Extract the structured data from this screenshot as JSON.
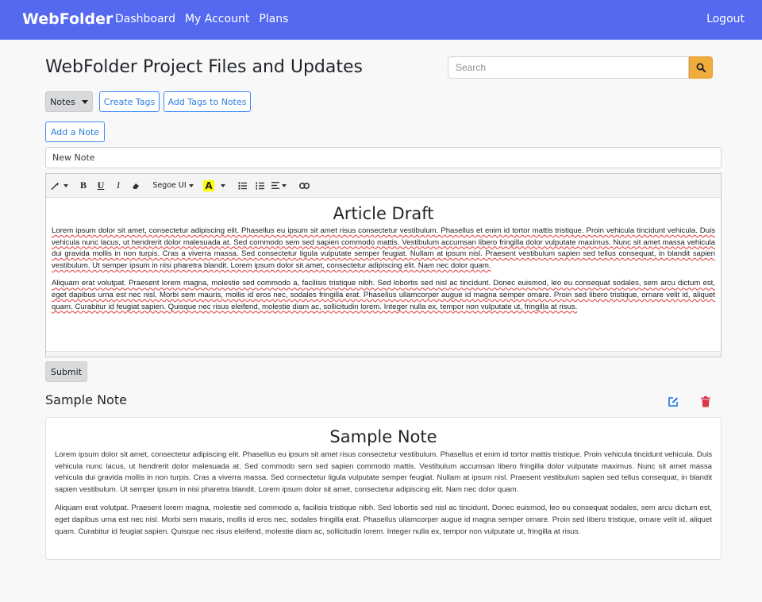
{
  "navbar": {
    "brand": "WebFolder",
    "links": [
      "Dashboard",
      "My Account",
      "Plans"
    ],
    "logout": "Logout",
    "bg_color": "#5468f0"
  },
  "page": {
    "title": "WebFolder Project Files and Updates"
  },
  "search": {
    "placeholder": "Search",
    "value": "",
    "button_icon": "search-icon",
    "button_color": "#f0ad3e"
  },
  "actions": {
    "notes_dropdown": "Notes",
    "create_tags": "Create Tags",
    "add_tags_to_notes": "Add Tags to Notes",
    "add_note": "Add a Note"
  },
  "new_note": {
    "title_value": "New Note"
  },
  "editor": {
    "toolbar": {
      "font_name": "Segoe UI",
      "icons": [
        "magic-icon",
        "bold-icon",
        "underline-icon",
        "italic-icon",
        "eraser-icon",
        "font-color-icon",
        "unordered-list-icon",
        "ordered-list-icon",
        "align-icon",
        "link-icon"
      ]
    },
    "heading": "Article Draft",
    "paragraphs": [
      "Lorem ipsum dolor sit amet, consectetur adipiscing elit. Phasellus eu ipsum sit amet risus consectetur vestibulum. Phasellus et enim id tortor mattis tristique. Proin vehicula tincidunt vehicula. Duis vehicula nunc lacus, ut hendrerit dolor malesuada at. Sed commodo sem sed sapien commodo mattis. Vestibulum accumsan libero fringilla dolor vulputate maximus. Nunc sit amet massa vehicula dui gravida mollis in non turpis. Cras a viverra massa. Sed consectetur ligula vulputate semper feugiat. Nullam at ipsum nisl. Praesent vestibulum sapien sed tellus consequat, in blandit sapien vestibulum. Ut semper ipsum in nisi pharetra blandit. Lorem ipsum dolor sit amet, consectetur adipiscing elit. Nam nec dolor quam.",
      "Aliquam erat volutpat. Praesent lorem magna, molestie sed commodo a, facilisis tristique nibh. Sed lobortis sed nisl ac tincidunt. Donec euismod, leo eu consequat sodales, sem arcu dictum est, eget dapibus urna est nec nisl. Morbi sem mauris, mollis id eros nec, sodales fringilla erat. Phasellus ullamcorper augue id magna semper ornare. Proin sed libero tristique, ornare velit id, aliquet quam. Curabitur id feugiat sapien. Quisque nec risus eleifend, molestie diam ac, sollicitudin lorem. Integer nulla ex, tempor non vulputate ut, fringilla at risus."
    ]
  },
  "submit_label": "Submit",
  "note": {
    "title": "Sample Note",
    "edit_icon": "edit-icon",
    "delete_icon": "trash-icon",
    "edit_color": "#1a73e8",
    "delete_color": "#dc3545",
    "heading": "Sample Note",
    "paragraphs": [
      "Lorem ipsum dolor sit amet, consectetur adipiscing elit. Phasellus eu ipsum sit amet risus consectetur vestibulum. Phasellus et enim id tortor mattis tristique. Proin vehicula tincidunt vehicula. Duis vehicula nunc lacus, ut hendrerit dolor malesuada at. Sed commodo sem sed sapien commodo mattis. Vestibulum accumsan libero fringilla dolor vulputate maximus. Nunc sit amet massa vehicula dui gravida mollis in non turpis. Cras a viverra massa. Sed consectetur ligula vulputate semper feugiat. Nullam at ipsum nisl. Praesent vestibulum sapien sed tellus consequat, in blandit sapien vestibulum. Ut semper ipsum in nisi pharetra blandit. Lorem ipsum dolor sit amet, consectetur adipiscing elit. Nam nec dolor quam.",
      "Aliquam erat volutpat. Praesent lorem magna, molestie sed commodo a, facilisis tristique nibh. Sed lobortis sed nisl ac tincidunt. Donec euismod, leo eu consequat sodales, sem arcu dictum est, eget dapibus urna est nec nisl. Morbi sem mauris, mollis id eros nec, sodales fringilla erat. Phasellus ullamcorper augue id magna semper ornare. Proin sed libero tristique, ornare velit id, aliquet quam. Curabitur id feugiat sapien. Quisque nec risus eleifend, molestie diam ac, sollicitudin lorem. Integer nulla ex, tempor non vulputate ut, fringilla at risus."
    ]
  }
}
